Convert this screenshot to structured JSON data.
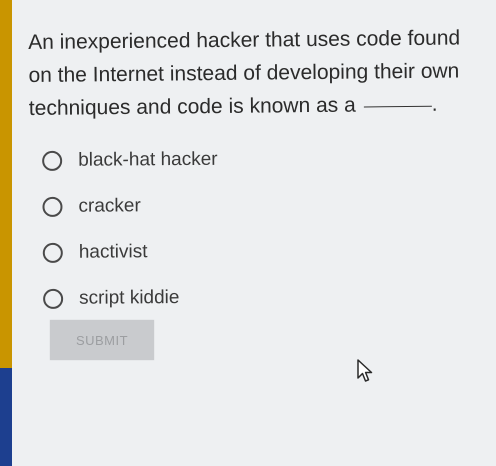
{
  "question": {
    "lines": [
      "An inexperienced hacker that uses code found",
      "on the Internet instead of developing their own",
      "techniques and code is known as a"
    ],
    "blank_suffix": "."
  },
  "options": [
    {
      "label": "black-hat hacker",
      "selected": false
    },
    {
      "label": "cracker",
      "selected": false
    },
    {
      "label": "hactivist",
      "selected": false
    },
    {
      "label": "script kiddie",
      "selected": false
    }
  ],
  "submit": {
    "label": "SUBMIT",
    "enabled": false
  },
  "colors": {
    "left_strip_top": "#c99500",
    "left_strip_bottom": "#1d3f8f",
    "background": "#eef0f2"
  },
  "icons": {
    "cursor": "mouse-pointer-icon"
  }
}
